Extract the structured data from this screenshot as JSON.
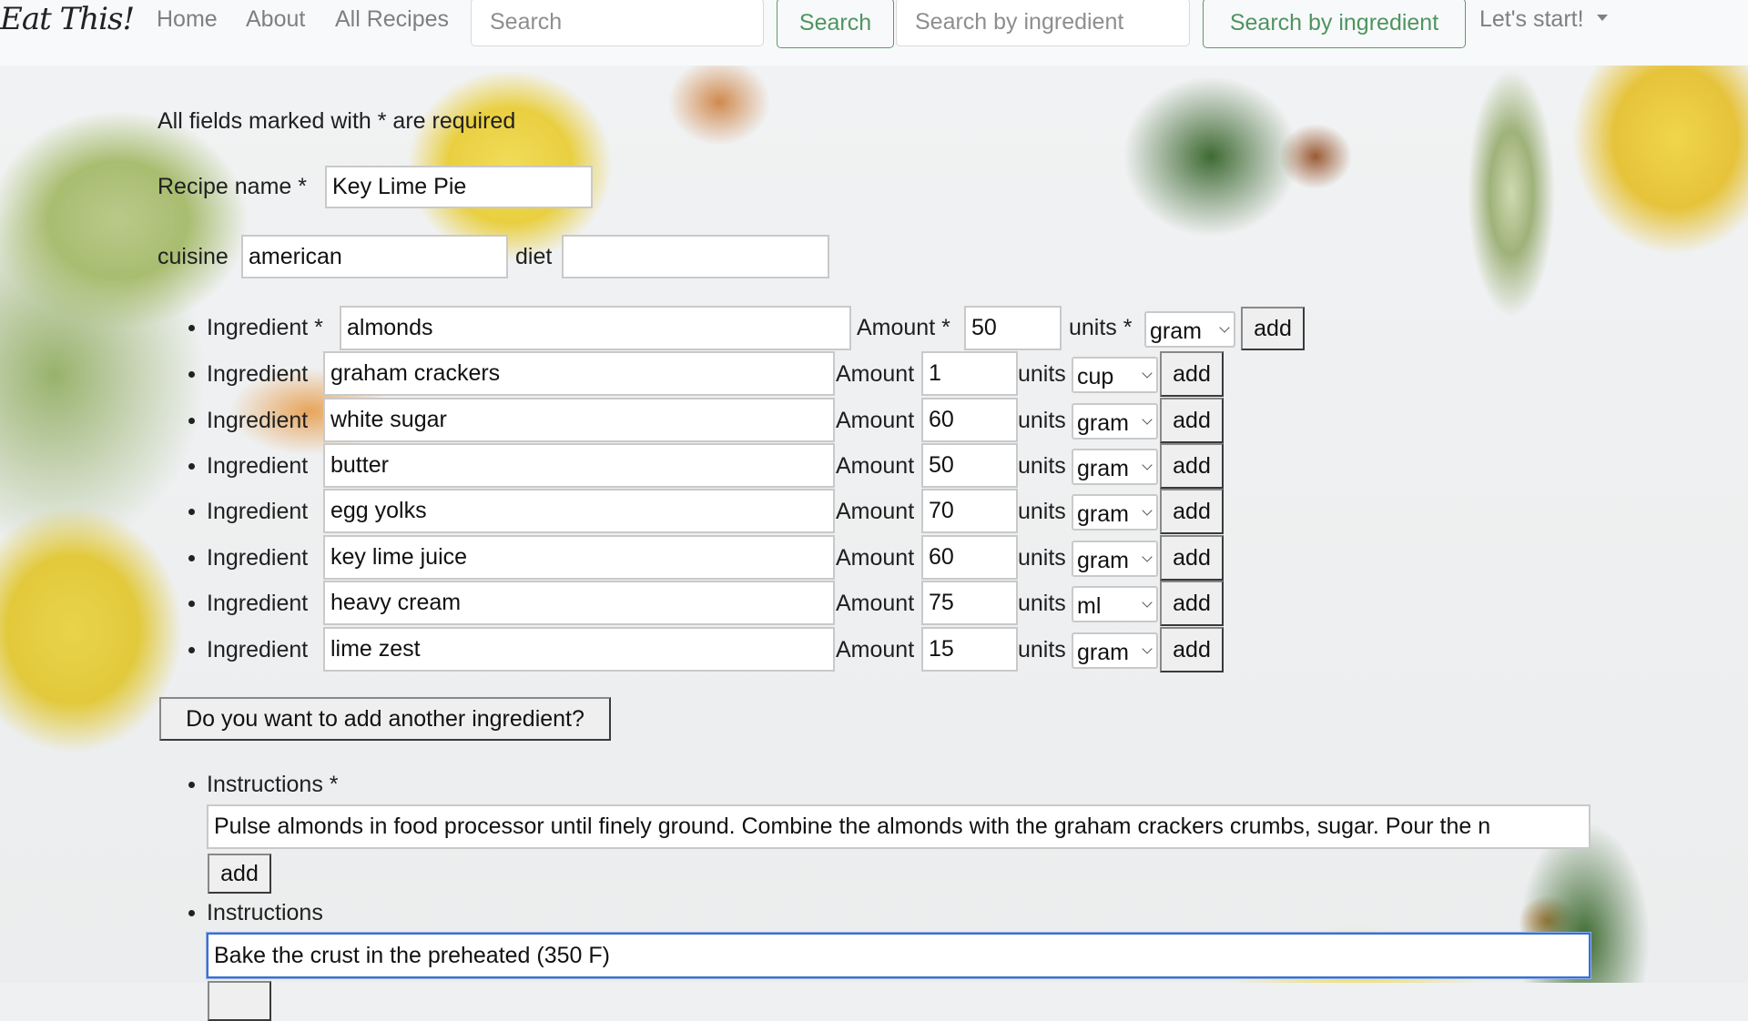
{
  "navbar": {
    "brand": "Eat This!",
    "links": [
      "Home",
      "About",
      "All Recipes"
    ],
    "search_placeholder": "Search",
    "search_button": "Search",
    "ingredient_search_placeholder": "Search by ingredient",
    "ingredient_search_button": "Search by ingredient",
    "dropdown_label": "Let's start!"
  },
  "form": {
    "required_note": "All fields marked with * are required",
    "recipe_name_label": "Recipe name *",
    "recipe_name_value": "Key Lime Pie",
    "cuisine_label": "cuisine",
    "cuisine_value": "american",
    "diet_label": "diet",
    "diet_value": "",
    "ingredients": [
      {
        "label": "Ingredient *",
        "name": "almonds",
        "amount_label": "Amount *",
        "amount": "50",
        "units_label": "units *",
        "unit": "gram",
        "add_label": "add"
      },
      {
        "label": "Ingredient",
        "name": "graham crackers",
        "amount_label": "Amount",
        "amount": "1",
        "units_label": "units",
        "unit": "cup",
        "add_label": "add"
      },
      {
        "label": "Ingredient",
        "name": "white sugar",
        "amount_label": "Amount",
        "amount": "60",
        "units_label": "units",
        "unit": "gram",
        "add_label": "add"
      },
      {
        "label": "Ingredient",
        "name": "butter",
        "amount_label": "Amount",
        "amount": "50",
        "units_label": "units",
        "unit": "gram",
        "add_label": "add"
      },
      {
        "label": "Ingredient",
        "name": "egg yolks",
        "amount_label": "Amount",
        "amount": "70",
        "units_label": "units",
        "unit": "gram",
        "add_label": "add"
      },
      {
        "label": "Ingredient",
        "name": "key lime juice",
        "amount_label": "Amount",
        "amount": "60",
        "units_label": "units",
        "unit": "gram",
        "add_label": "add"
      },
      {
        "label": "Ingredient",
        "name": "heavy cream",
        "amount_label": "Amount",
        "amount": "75",
        "units_label": "units",
        "unit": "ml",
        "add_label": "add"
      },
      {
        "label": "Ingredient",
        "name": "lime zest",
        "amount_label": "Amount",
        "amount": "15",
        "units_label": "units",
        "unit": "gram",
        "add_label": "add"
      }
    ],
    "add_ingredient_button": "Do you want to add another ingredient?",
    "instructions": [
      {
        "label": "Instructions *",
        "value": "Pulse almonds in food processor until finely ground. Combine the almonds with the graham crackers crumbs, sugar. Pour the n",
        "add_label": "add"
      },
      {
        "label": "Instructions",
        "value": "Bake the crust in the preheated (350 F)"
      }
    ]
  }
}
